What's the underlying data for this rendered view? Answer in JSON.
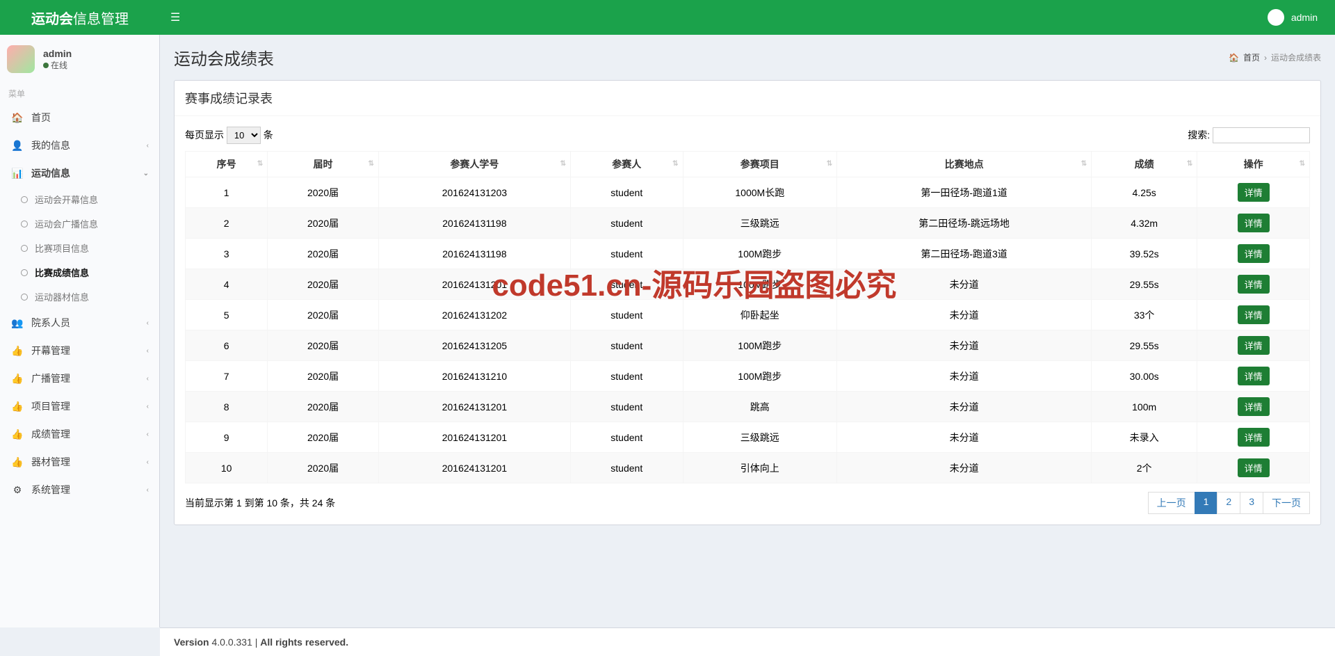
{
  "app": {
    "brand_bold": "运动会",
    "brand_text": "信息管理"
  },
  "headerUser": {
    "name": "admin"
  },
  "sidebarUser": {
    "name": "admin",
    "status": "在线"
  },
  "menuHeader": "菜单",
  "nav": {
    "home": "首页",
    "myinfo": "我的信息",
    "sportinfo": "运动信息",
    "deptpersons": "院系人员",
    "openingmgmt": "开幕管理",
    "broadcastmgmt": "广播管理",
    "eventmgmt": "项目管理",
    "scoremgmt": "成绩管理",
    "equipmgmt": "器材管理",
    "sysmgmt": "系统管理"
  },
  "subnav": {
    "openinginfo": "运动会开幕信息",
    "broadcastinfo": "运动会广播信息",
    "eventinfo": "比赛项目信息",
    "scoreinfo": "比赛成绩信息",
    "equipinfo": "运动器材信息"
  },
  "page": {
    "title": "运动会成绩表",
    "breadcrumb_home": "首页",
    "breadcrumb_current": "运动会成绩表"
  },
  "box": {
    "title": "赛事成绩记录表"
  },
  "tableControls": {
    "perPagePre": "每页显示",
    "perPageSuf": "条",
    "perPageValue": "10",
    "searchLabel": "搜索:"
  },
  "columns": {
    "seq": "序号",
    "term": "届时",
    "sid": "参赛人学号",
    "name": "参赛人",
    "event": "参赛项目",
    "venue": "比赛地点",
    "score": "成绩",
    "action": "操作"
  },
  "detailBtn": "详情",
  "rows": [
    {
      "seq": "1",
      "term": "2020届",
      "sid": "201624131203",
      "name": "student",
      "event": "1000M长跑",
      "venue": "第一田径场-跑道1道",
      "score": "4.25s"
    },
    {
      "seq": "2",
      "term": "2020届",
      "sid": "201624131198",
      "name": "student",
      "event": "三级跳远",
      "venue": "第二田径场-跳远场地",
      "score": "4.32m"
    },
    {
      "seq": "3",
      "term": "2020届",
      "sid": "201624131198",
      "name": "student",
      "event": "100M跑步",
      "venue": "第二田径场-跑道3道",
      "score": "39.52s"
    },
    {
      "seq": "4",
      "term": "2020届",
      "sid": "201624131201",
      "name": "student",
      "event": "100M跑步",
      "venue": "未分道",
      "score": "29.55s"
    },
    {
      "seq": "5",
      "term": "2020届",
      "sid": "201624131202",
      "name": "student",
      "event": "仰卧起坐",
      "venue": "未分道",
      "score": "33个"
    },
    {
      "seq": "6",
      "term": "2020届",
      "sid": "201624131205",
      "name": "student",
      "event": "100M跑步",
      "venue": "未分道",
      "score": "29.55s"
    },
    {
      "seq": "7",
      "term": "2020届",
      "sid": "201624131210",
      "name": "student",
      "event": "100M跑步",
      "venue": "未分道",
      "score": "30.00s"
    },
    {
      "seq": "8",
      "term": "2020届",
      "sid": "201624131201",
      "name": "student",
      "event": "跳高",
      "venue": "未分道",
      "score": "100m"
    },
    {
      "seq": "9",
      "term": "2020届",
      "sid": "201624131201",
      "name": "student",
      "event": "三级跳远",
      "venue": "未分道",
      "score": "未录入"
    },
    {
      "seq": "10",
      "term": "2020届",
      "sid": "201624131201",
      "name": "student",
      "event": "引体向上",
      "venue": "未分道",
      "score": "2个"
    }
  ],
  "tableInfo": "当前显示第 1 到第 10 条，共 24 条",
  "pagination": {
    "prev": "上一页",
    "next": "下一页",
    "pages": [
      "1",
      "2",
      "3"
    ],
    "active": "1"
  },
  "footer": {
    "versionLabel": "Version",
    "version": "4.0.0.331",
    "rights": "All rights reserved."
  },
  "watermark": "code51.cn-源码乐园盗图必究"
}
